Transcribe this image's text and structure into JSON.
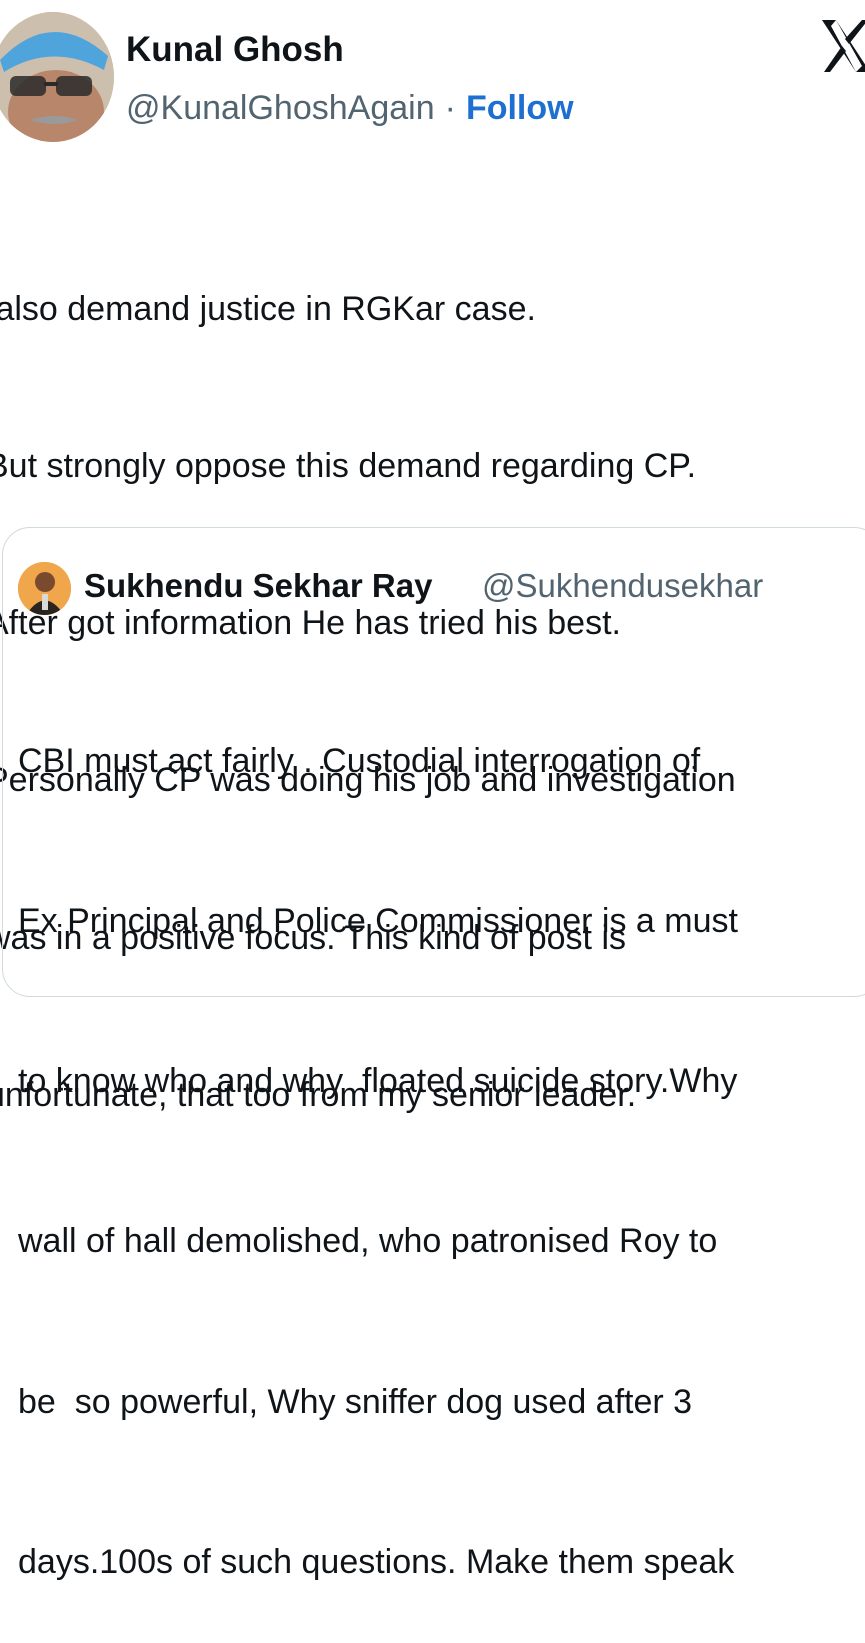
{
  "author": {
    "name": "Kunal Ghosh",
    "handle": "@KunalGhoshAgain",
    "separator": "·",
    "follow_label": "Follow",
    "avatar_icon": "person-avatar-icon"
  },
  "brand": {
    "icon": "x-logo-icon"
  },
  "tweet": {
    "lines": [
      " also demand justice in RGKar case.",
      "But strongly oppose this demand regarding CP.",
      "After got information He has tried his best.",
      "Personally CP was doing his job and investigation",
      "was in a positive focus. This kind of post is",
      "unfortunate, that too from my senior leader."
    ]
  },
  "quoted": {
    "name": "Sukhendu Sekhar Ray",
    "handle": "@Sukhendusekhar",
    "avatar_icon": "person-avatar-icon",
    "lines": [
      "CBI must act fairly . Custodial interrogation of",
      "Ex Principal and Police Commissioner is a must",
      "to know who and why  floated suicide story.Why",
      "wall of hall demolished, who patronised Roy to",
      "be  so powerful, Why sniffer dog used after 3",
      "days.100s of such questions. Make them speak"
    ]
  },
  "colors": {
    "link_blue": "#1d6fd1",
    "secondary_text": "#536471",
    "border": "#cfd9de",
    "text": "#0f1419"
  }
}
